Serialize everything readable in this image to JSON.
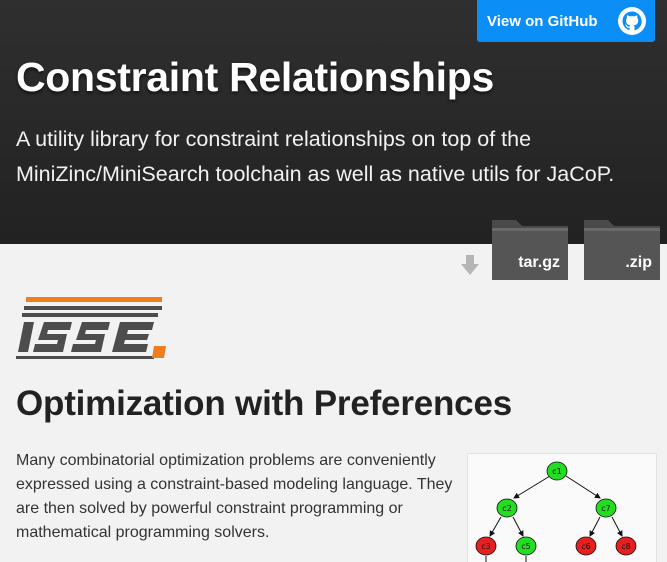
{
  "github_button": {
    "label": "View on GitHub",
    "icon": "github-octocat-icon"
  },
  "header": {
    "title": "Constraint Relationships",
    "tagline": "A utility library for constraint relationships on top of the MiniZinc/MiniSearch toolchain as well as native utils for JaCoP."
  },
  "downloads": {
    "arrow_icon": "download-arrow-icon",
    "items": [
      {
        "label": "tar.gz",
        "icon": "folder-icon"
      },
      {
        "label": ".zip",
        "icon": "folder-icon"
      }
    ]
  },
  "logo": {
    "alt": "ISSE"
  },
  "section": {
    "title": "Optimization with Preferences",
    "paragraph": "Many combinatorial optimization problems are conveniently expressed using a constraint-based modeling language. They are then solved by powerful constraint programming or mathematical programming solvers."
  },
  "tree": {
    "nodes": [
      {
        "label": "c1",
        "color": "#22dd22"
      },
      {
        "label": "c2",
        "color": "#22dd22"
      },
      {
        "label": "c7",
        "color": "#22dd22"
      },
      {
        "label": "c3",
        "color": "#e52020"
      },
      {
        "label": "c5",
        "color": "#22dd22"
      },
      {
        "label": "c6",
        "color": "#e52020"
      },
      {
        "label": "c8",
        "color": "#e52020"
      }
    ]
  },
  "colors": {
    "header_bg": "#262626",
    "github_blue": "#0b8ef5",
    "logo_orange": "#f07d1e",
    "logo_gray": "#4d4d4d"
  }
}
